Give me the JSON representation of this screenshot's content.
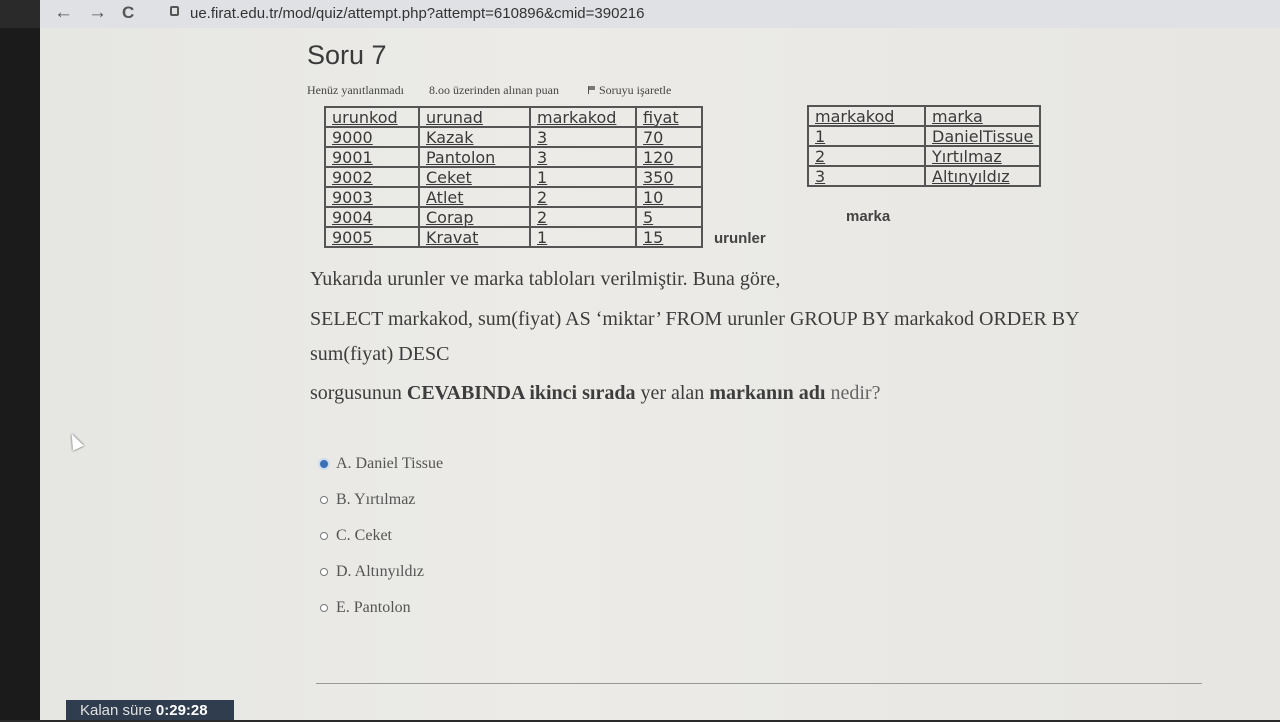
{
  "browser": {
    "back": "←",
    "forward": "→",
    "reload": "C",
    "url": "ue.firat.edu.tr/mod/quiz/attempt.php?attempt=610896&cmid=390216"
  },
  "question": {
    "title": "Soru 7",
    "status": "Henüz yanıtlanmadı",
    "points": "8.oo üzerinden alınan puan",
    "flag_label": "Soruyu işaretle"
  },
  "urunler_table": {
    "label": "urunler",
    "headers": [
      "urunkod",
      "urunad",
      "markakod",
      "fiyat"
    ],
    "rows": [
      [
        "9000",
        "Kazak",
        "3",
        "70"
      ],
      [
        "9001",
        "Pantolon",
        "3",
        "120"
      ],
      [
        "9002",
        "Ceket",
        "1",
        "350"
      ],
      [
        "9003",
        "Atlet",
        "2",
        "10"
      ],
      [
        "9004",
        "Corap",
        "2",
        "5"
      ],
      [
        "9005",
        "Kravat",
        "1",
        "15"
      ]
    ]
  },
  "marka_table": {
    "label": "marka",
    "headers": [
      "markakod",
      "marka"
    ],
    "rows": [
      [
        "1",
        "DanielTissue"
      ],
      [
        "2",
        "Yırtılmaz"
      ],
      [
        "3",
        "Altınyıldız"
      ]
    ]
  },
  "text": {
    "line1": "Yukarıda urunler ve marka tabloları verilmiştir. Buna göre,",
    "line2": "SELECT markakod, sum(fiyat) AS ‘miktar’ FROM urunler GROUP BY markakod ORDER BY",
    "line3": "sum(fiyat) DESC",
    "line4_a": "sorgusunun ",
    "line4_b": "CEVABINDA ikinci sırada",
    "line4_c": " yer alan ",
    "line4_d": "markanın adı",
    "line4_e": " nedir?"
  },
  "options": [
    {
      "label": "A. Daniel Tissue",
      "selected": true
    },
    {
      "label": "B. Yırtılmaz",
      "selected": false
    },
    {
      "label": "C. Ceket",
      "selected": false
    },
    {
      "label": "D. Altınyıldız",
      "selected": false
    },
    {
      "label": "E. Pantolon",
      "selected": false
    }
  ],
  "timer": {
    "label": "Kalan süre ",
    "value": "0:29:28"
  },
  "colors": {
    "accent": "#3b6fb6",
    "timer_bg": "#2f3d4f"
  }
}
